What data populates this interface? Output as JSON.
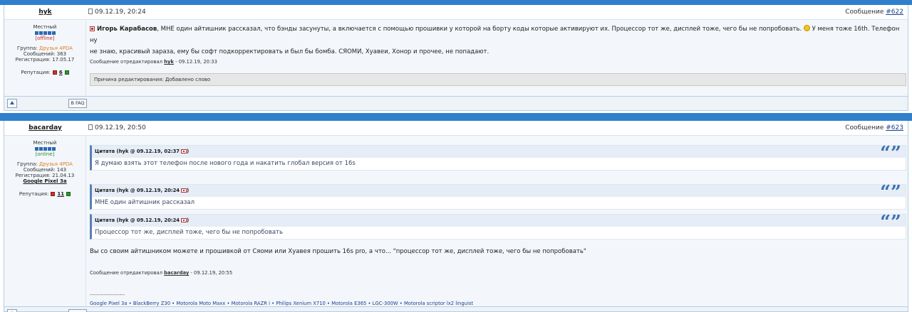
{
  "post1": {
    "author": "hyk",
    "date": "09.12.19, 20:24",
    "msg_label": "Сообщение ",
    "msg_num": "#622",
    "rank": "Местный",
    "status": "[offline]",
    "group_label": "Группа: ",
    "group_value": "Друзья 4PDA",
    "messages": "Сообщений: 363",
    "registered": "Регистрация: 17.05.17",
    "rep_label": "Репутация:",
    "rep_value": "6",
    "addressee": "Игорь Карабасов",
    "text_a": ", МНЕ один айтишник рассказал, что бэнды засунуты, а включается с помощью прошивки у которой на борту коды которые активируют их. Процессор тот же, дисплей тоже, чего бы не попробовать.",
    "text_b": " У меня тоже 16th. Телефон ну",
    "text_c": "не знаю, красивый зараза, ему бы софт подкорректировать и был бы бомба. СЯОМИ, Хуавеи, Хонор и прочее, не попадают.",
    "edited_prefix": "Сообщение отредактировал ",
    "edited_by": "hyk",
    "edited_suffix": " - 09.12.19, 20:33",
    "reason": "Причина редактирования: Добавлено слово"
  },
  "actions": {
    "faq_label": "В FAQ"
  },
  "post2": {
    "author": "bacarday",
    "date": "09.12.19, 20:50",
    "msg_label": "Сообщение ",
    "msg_num": "#623",
    "rank": "Местный",
    "status": "[online]",
    "group_label": "Группа: ",
    "group_value": "Друзья 4PDA",
    "messages": "Сообщений: 143",
    "registered": "Регистрация: 21.04.13",
    "device": "Google Pixel 3a",
    "rep_label": "Репутация:",
    "rep_value": "11",
    "quotes": [
      {
        "header": "Цитата (hyk @ 09.12.19, 02:37",
        "close": ")",
        "text": "Я думаю взять этот телефон после нового года и накатить глобал версия от 16s"
      },
      {
        "header": "Цитата (hyk @ 09.12.19, 20:24",
        "close": ")",
        "text": "МНЕ один айтишник рассказал"
      },
      {
        "header": "Цитата (hyk @ 09.12.19, 20:24",
        "close": ")",
        "text": "Процессор тот же, дисплей тоже, чего бы не попробовать"
      }
    ],
    "quote_mark": "“”",
    "reply": "Вы со своим айтишником можете и прошивкой от Сяоми или Хуавея прошить 16s pro, а что... \"процессор тот же, дисплей тоже, чего бы не попробовать\"",
    "edited_prefix": "Сообщение отредактировал ",
    "edited_by": "bacarday",
    "edited_suffix": " - 09.12.19, 20:55",
    "sig_line": "--------------------",
    "signature": "Google Pixel 3a • BlackBerry Z30 • Motorola Moto Maxx • Motorola RAZR i • Philips Xenium X710 • Motorola E365 • LGC-300W • Motorola scriptor lx2 linguist"
  }
}
